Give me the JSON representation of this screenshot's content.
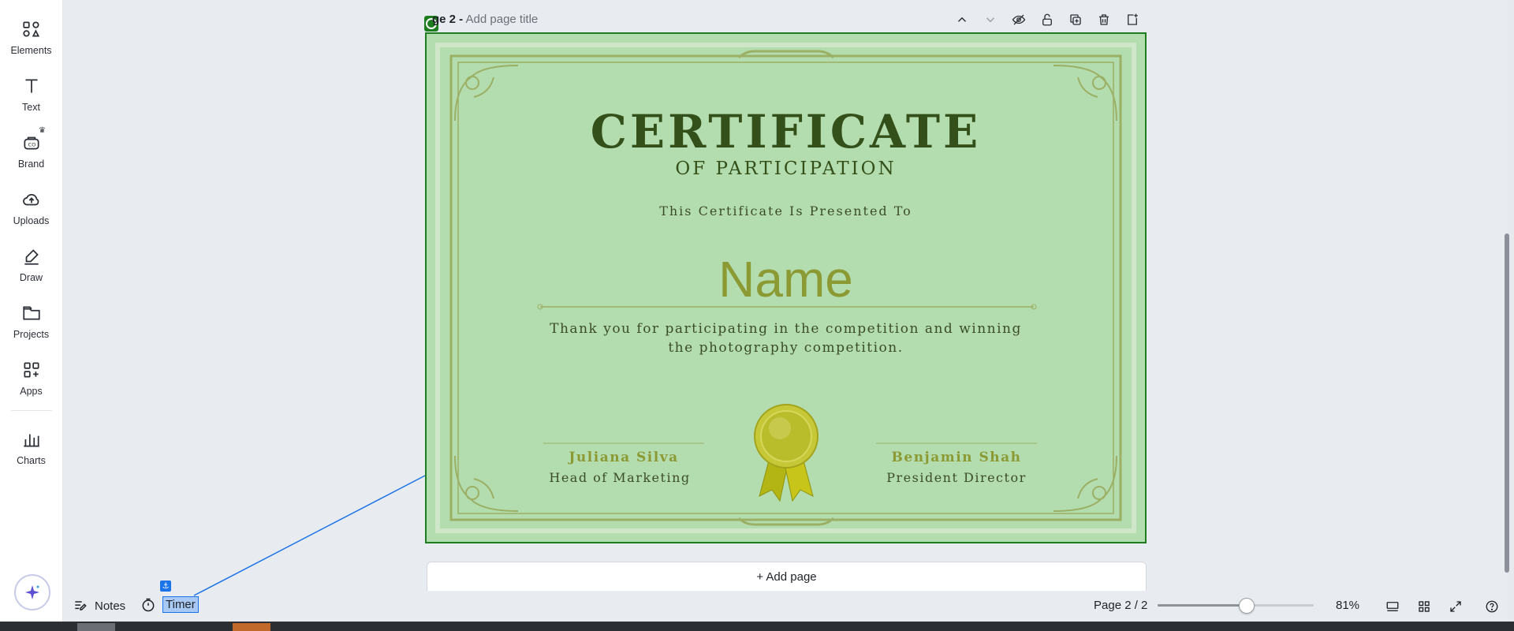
{
  "sidebar": {
    "items": [
      {
        "label": "Elements",
        "icon": "elements-icon"
      },
      {
        "label": "Text",
        "icon": "text-icon"
      },
      {
        "label": "Brand",
        "icon": "brand-icon"
      },
      {
        "label": "Uploads",
        "icon": "uploads-icon"
      },
      {
        "label": "Draw",
        "icon": "draw-icon"
      },
      {
        "label": "Projects",
        "icon": "projects-icon"
      },
      {
        "label": "Apps",
        "icon": "apps-icon"
      },
      {
        "label": "Charts",
        "icon": "charts-icon"
      }
    ]
  },
  "page_header": {
    "page_prefix": "ge 2 -",
    "title_placeholder": "Add page title"
  },
  "certificate": {
    "title": "CERTIFICATE",
    "subtitle": "OF PARTICIPATION",
    "presented_to": "This Certificate Is Presented To",
    "name": "Name",
    "thanks_line1": "Thank you for participating in the competition and winning",
    "thanks_line2": "the photography competition.",
    "signer_left_name": "Juliana Silva",
    "signer_left_role": "Head of Marketing",
    "signer_right_name": "Benjamin Shah",
    "signer_right_role": "President Director",
    "colors": {
      "background": "#b3dcaf",
      "border": "#1c7c1e",
      "ink": "#34501a",
      "accent": "#8c9a34"
    }
  },
  "add_page_label": "+ Add page",
  "bottom_bar": {
    "notes_label": "Notes",
    "timer_label": "Timer",
    "page_indicator": "Page 2 / 2",
    "zoom_value": 81,
    "zoom_label": "81%"
  }
}
